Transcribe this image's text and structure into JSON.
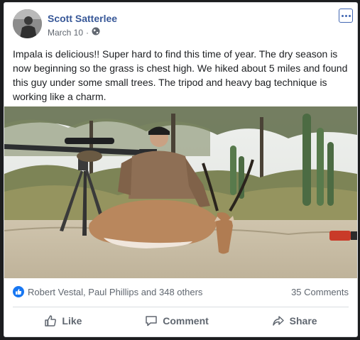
{
  "post": {
    "author": "Scott Satterlee",
    "date": "March 10",
    "separator": "·",
    "privacy_icon": "globe-icon",
    "text": "Impala is delicious!! Super hard to find this time of year. The dry season is now beginning so the grass is chest high. We hiked about 5 miles and found this guy under some small trees. The tripod and heavy bag technique is working like a charm."
  },
  "reactions": {
    "icon": "like-icon",
    "summary": "Robert Vestal, Paul Phillips and 348 others",
    "comments": "35 Comments"
  },
  "actions": {
    "like": "Like",
    "comment": "Comment",
    "share": "Share"
  },
  "colors": {
    "author_link": "#385898",
    "like_blue": "#1877f2",
    "muted": "#606770"
  }
}
